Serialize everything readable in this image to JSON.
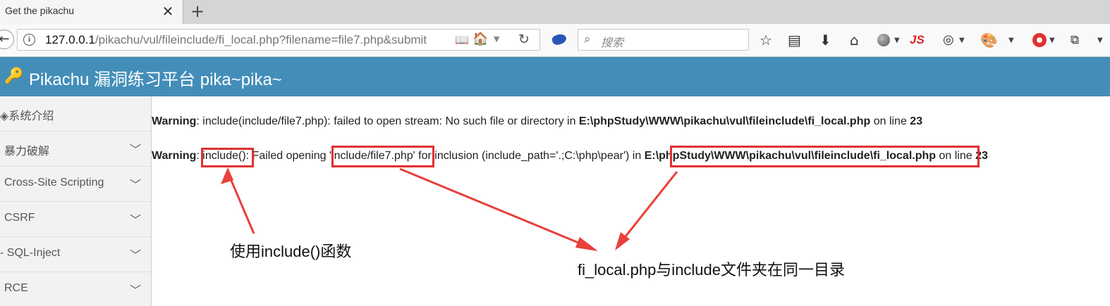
{
  "tab": {
    "title": "Get the pikachu",
    "close": "✕",
    "new_tab": "+"
  },
  "nav": {
    "url_host": "127.0.0.1",
    "url_path": "/pikachu/vul/fileinclude/fi_local.php?filename=file7.php&submit",
    "search_placeholder": "搜索",
    "js_label": "JS"
  },
  "header": {
    "title": "Pikachu 漏洞练习平台 pika~pika~"
  },
  "sidebar": {
    "items": [
      {
        "label": "系统介绍"
      },
      {
        "label": "暴力破解"
      },
      {
        "label": "Cross-Site Scripting"
      },
      {
        "label": "CSRF"
      },
      {
        "label": "SQL-Inject"
      },
      {
        "label": "RCE"
      }
    ]
  },
  "main": {
    "warning1": {
      "label": "Warning",
      "text": ": include(include/file7.php): failed to open stream: No such file or directory in ",
      "path": "E:\\phpStudy\\WWW\\pikachu\\vul\\fileinclude\\fi_local.php",
      "line_text": " on line ",
      "line": "23"
    },
    "warning2": {
      "label": "Warning",
      "sep": ": ",
      "func": "include():",
      "text1": " Failed opening ",
      "file": "'include/file7.php'",
      "text2": " for inclusion (include_path='.;C:\\php\\pear') in ",
      "path": "E:\\phpStudy\\WWW\\pikachu\\vul\\fileinclude\\fi_local.php",
      "line_text": " on line ",
      "line": "23"
    }
  },
  "annotations": {
    "note1": "使用include()函数",
    "note2": "fi_local.php与include文件夹在同一目录"
  },
  "colors": {
    "header_bg": "#438eb9",
    "highlight": "#e03030"
  }
}
